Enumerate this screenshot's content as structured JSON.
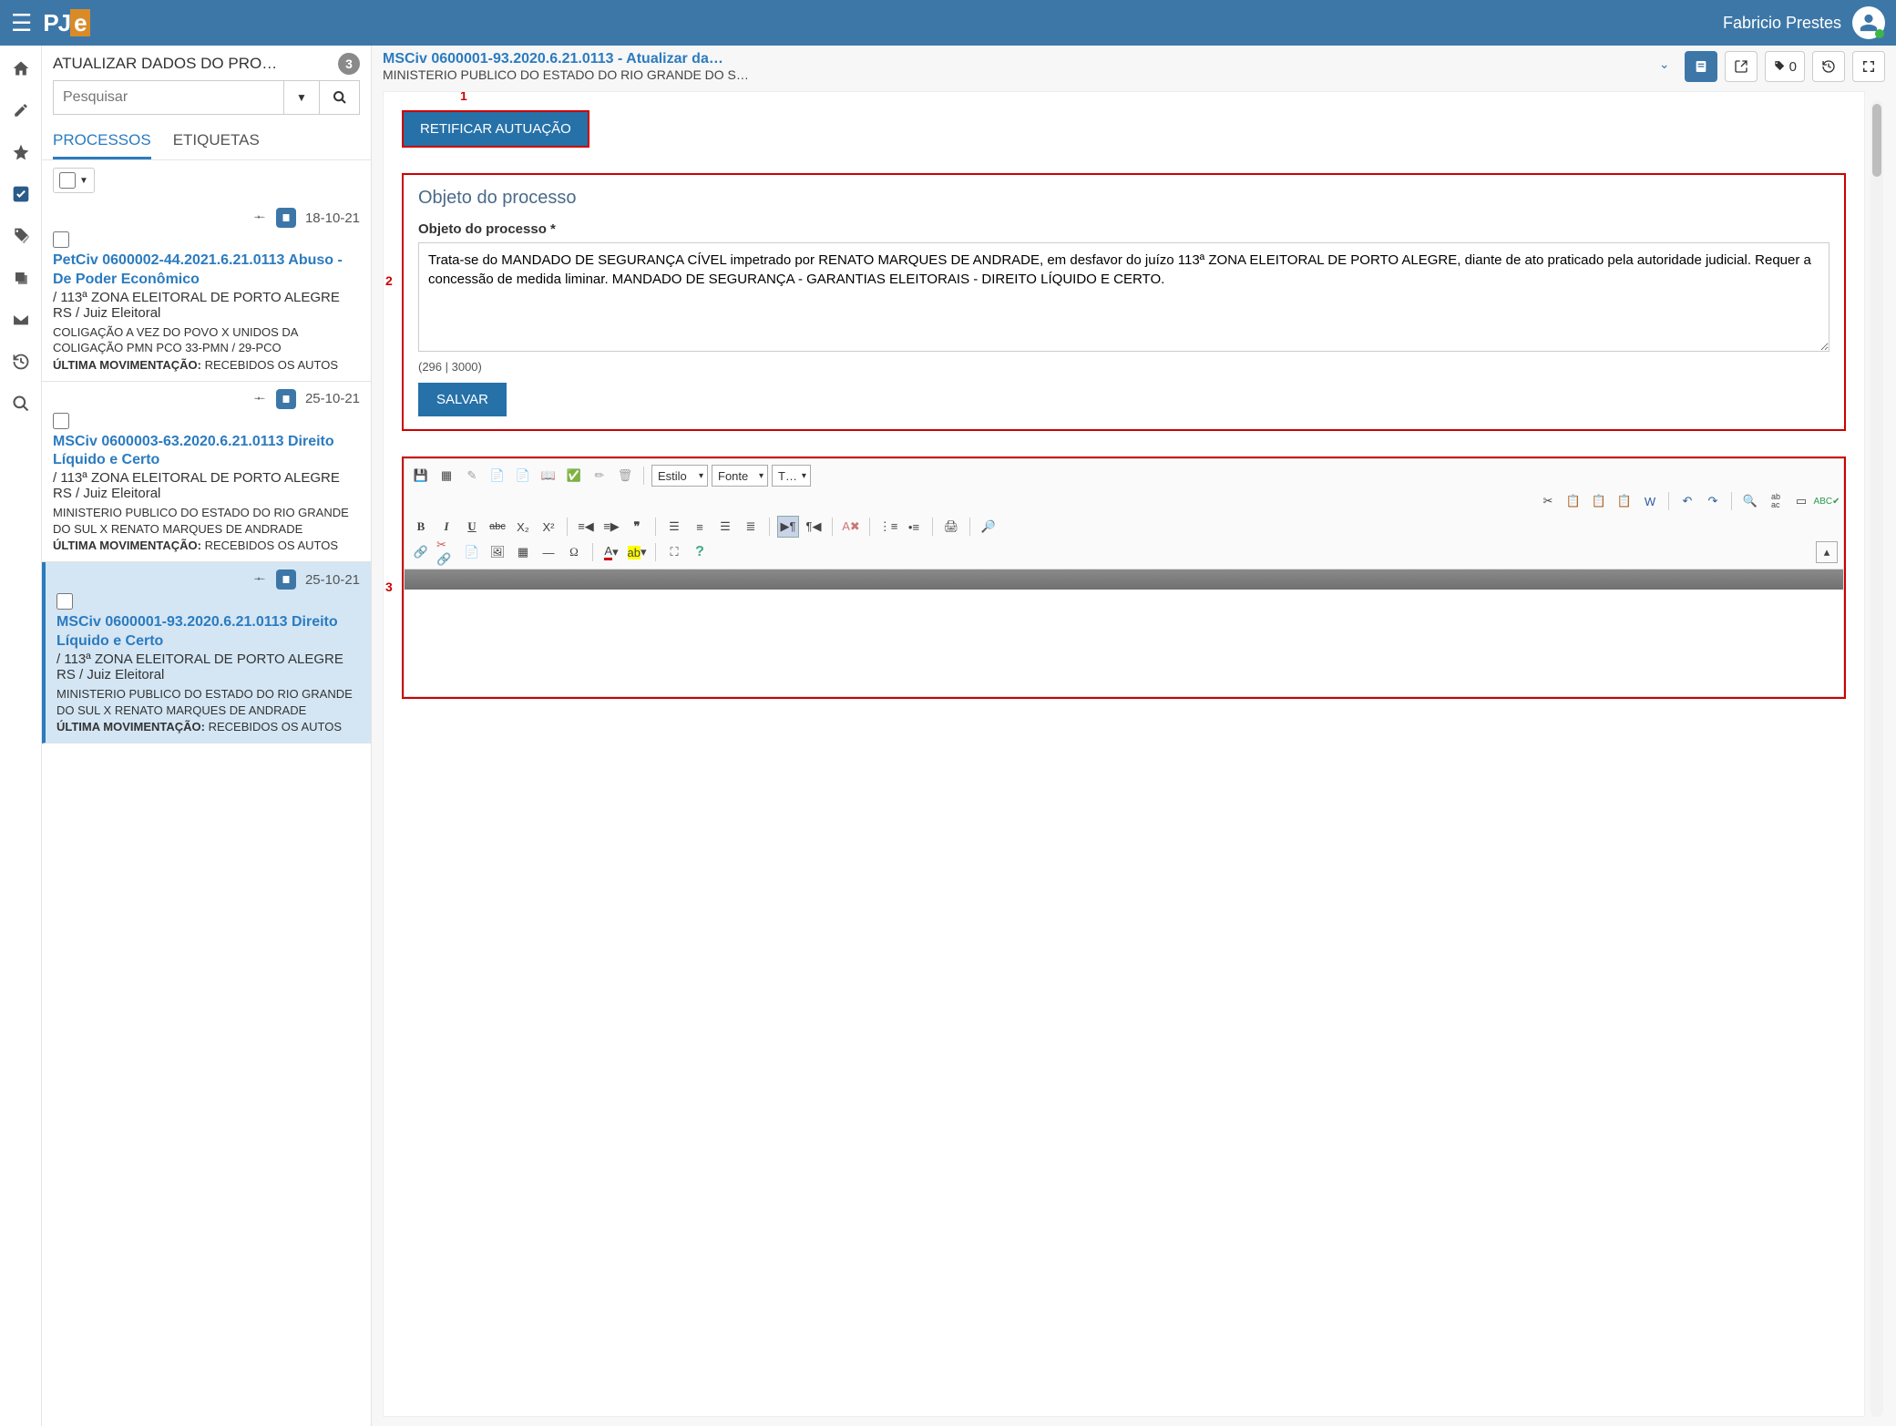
{
  "topbar": {
    "logo_prefix": "PJ",
    "logo_suffix": "e",
    "user": "Fabricio Prestes"
  },
  "side": {
    "title": "ATUALIZAR DADOS DO PRO…",
    "count": "3",
    "search_placeholder": "Pesquisar",
    "tab_proc": "PROCESSOS",
    "tab_etq": "ETIQUETAS"
  },
  "cards": [
    {
      "date": "18-10-21",
      "title": "PetCiv 0600002-44.2021.6.21.0113 Abuso - De Poder Econômico",
      "sub": "/ 113ª ZONA ELEITORAL DE PORTO ALEGRE RS / Juiz Eleitoral",
      "body": "COLIGAÇÃO A VEZ DO POVO X UNIDOS DA COLIGAÇÃO PMN PCO 33-PMN / 29-PCO",
      "last_label": "ÚLTIMA MOVIMENTAÇÃO:",
      "last_val": "RECEBIDOS OS AUTOS",
      "selected": false
    },
    {
      "date": "25-10-21",
      "title": "MSCiv 0600003-63.2020.6.21.0113 Direito Líquido e Certo",
      "sub": "/ 113ª ZONA ELEITORAL DE PORTO ALEGRE RS / Juiz Eleitoral",
      "body": "MINISTERIO PUBLICO DO ESTADO DO RIO GRANDE DO SUL X RENATO MARQUES DE ANDRADE",
      "last_label": "ÚLTIMA MOVIMENTAÇÃO:",
      "last_val": "RECEBIDOS OS AUTOS",
      "selected": false
    },
    {
      "date": "25-10-21",
      "title": "MSCiv 0600001-93.2020.6.21.0113 Direito Líquido e Certo",
      "sub": "/ 113ª ZONA ELEITORAL DE PORTO ALEGRE RS / Juiz Eleitoral",
      "body": "MINISTERIO PUBLICO DO ESTADO DO RIO GRANDE DO SUL X RENATO MARQUES DE ANDRADE",
      "last_label": "ÚLTIMA MOVIMENTAÇÃO:",
      "last_val": "RECEBIDOS OS AUTOS",
      "selected": true
    }
  ],
  "main": {
    "title": "MSCiv 0600001-93.2020.6.21.0113 - Atualizar da…",
    "subtitle": "MINISTERIO PUBLICO DO ESTADO DO RIO GRANDE DO S…",
    "tag_count": "0",
    "btn_retificar": "RETIFICAR AUTUAÇÃO",
    "obj_section_title": "Objeto do processo",
    "obj_label": "Objeto do processo *",
    "obj_value": "Trata-se do MANDADO DE SEGURANÇA CÍVEL impetrado por RENATO MARQUES DE ANDRADE, em desfavor do juízo 113ª ZONA ELEITORAL DE PORTO ALEGRE, diante de ato praticado pela autoridade judicial. Requer a concessão de medida liminar. MANDADO DE SEGURANÇA - GARANTIAS ELEITORAIS - DIREITO LÍQUIDO E CERTO.",
    "counter": "(296 | 3000)",
    "btn_salvar": "SALVAR",
    "ed_estilo": "Estilo",
    "ed_fonte": "Fonte",
    "ed_tam": "T…",
    "annot1": "1",
    "annot2": "2",
    "annot3": "3"
  }
}
